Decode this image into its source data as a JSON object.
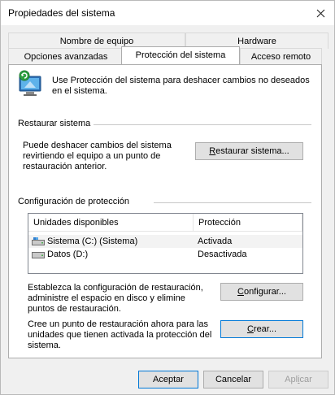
{
  "window": {
    "title": "Propiedades del sistema"
  },
  "tabs": [
    {
      "label": "Nombre de equipo",
      "active": false
    },
    {
      "label": "Hardware",
      "active": false
    },
    {
      "label": "Opciones avanzadas",
      "active": false
    },
    {
      "label": "Protección del sistema",
      "active": true
    },
    {
      "label": "Acceso remoto",
      "active": false
    }
  ],
  "intro": {
    "text": "Use Protección del sistema para deshacer cambios no deseados en el sistema."
  },
  "restore": {
    "heading": "Restaurar sistema",
    "description": "Puede deshacer cambios del sistema revirtiendo el equipo a un punto de restauración anterior.",
    "button_first": "R",
    "button_rest": "estaurar sistema..."
  },
  "protection": {
    "heading": "Configuración de protección",
    "columns": [
      "Unidades disponibles",
      "Protección"
    ],
    "drives": [
      {
        "name": "Sistema (C:) (Sistema)",
        "status": "Activada",
        "icon": "system-drive-icon"
      },
      {
        "name": "Datos (D:)",
        "status": "Desactivada",
        "icon": "drive-icon"
      }
    ],
    "configure_text": "Establezca la configuración de restauración, administre el espacio en disco y elimine puntos de restauración.",
    "configure_button_first": "C",
    "configure_button_rest": "onfigurar...",
    "create_text": "Cree un punto de restauración ahora para las unidades que tienen activada la protección del sistema.",
    "create_button_first": "C",
    "create_button_rest": "rear..."
  },
  "footer": {
    "accept": "Aceptar",
    "cancel": "Cancelar",
    "apply_first": "A",
    "apply_mid": "pl",
    "apply_u": "i",
    "apply_rest": "car"
  },
  "colors": {
    "accent": "#0078d7",
    "panel": "#ffffff",
    "window": "#f0f0f0"
  }
}
